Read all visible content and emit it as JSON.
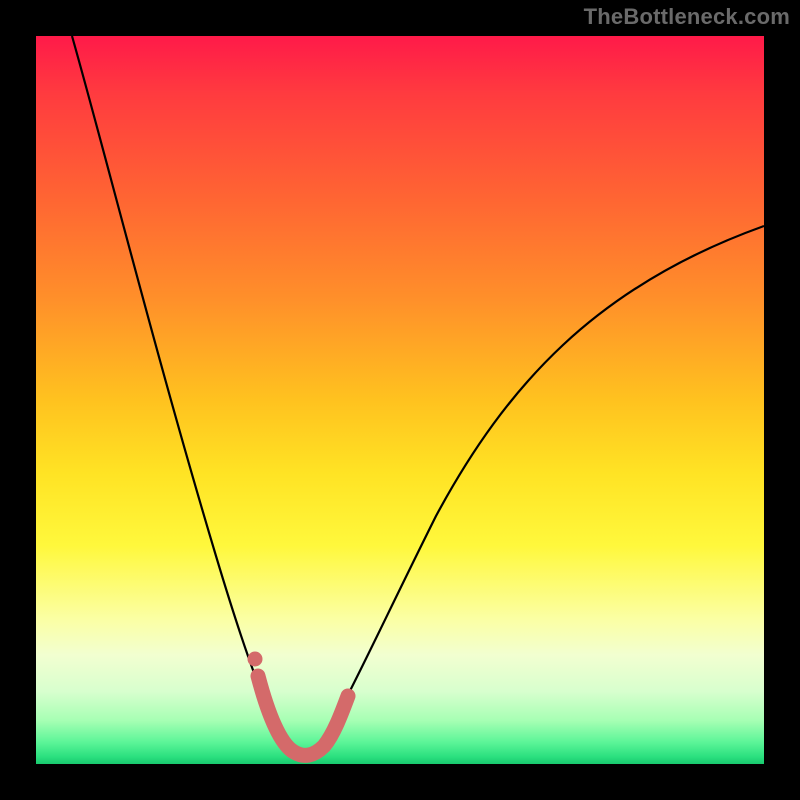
{
  "watermark": "TheBottleneck.com",
  "colors": {
    "frame": "#000000",
    "curve_main": "#000000",
    "curve_marker": "#d46a6a"
  },
  "chart_data": {
    "type": "line",
    "title": "",
    "xlabel": "",
    "ylabel": "",
    "xlim": [
      0,
      100
    ],
    "ylim": [
      0,
      100
    ],
    "grid": false,
    "legend": false,
    "series": [
      {
        "name": "bottleneck-curve",
        "x": [
          5,
          8,
          11,
          14,
          17,
          20,
          23,
          26,
          28,
          30,
          32,
          34,
          36,
          38,
          40,
          45,
          50,
          55,
          60,
          65,
          70,
          75,
          80,
          85,
          90,
          95,
          100
        ],
        "y": [
          100,
          88,
          76,
          65,
          55,
          45,
          36,
          28,
          22,
          16,
          10,
          5,
          2,
          1,
          2,
          10,
          22,
          34,
          44,
          52,
          58,
          63,
          67,
          70,
          72,
          74,
          75
        ]
      },
      {
        "name": "marker-segment",
        "x": [
          30,
          31,
          32,
          33,
          34,
          35,
          36,
          37,
          38,
          39,
          40
        ],
        "y": [
          14,
          9,
          5,
          3,
          2,
          1.5,
          1.5,
          2,
          3,
          5,
          8
        ]
      }
    ],
    "annotations": [
      {
        "name": "isolated-dot",
        "x": 30.5,
        "y": 16
      }
    ]
  }
}
